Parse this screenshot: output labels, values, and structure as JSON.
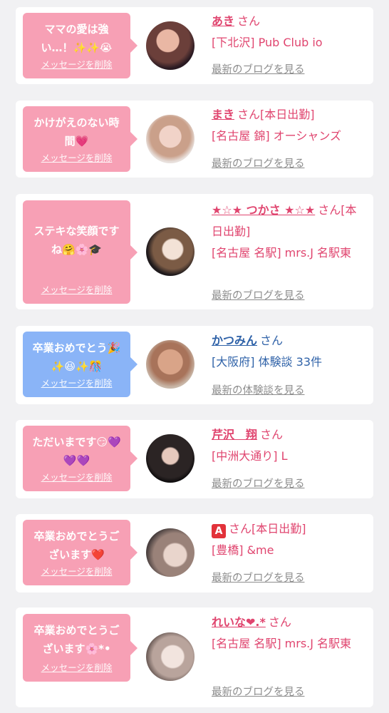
{
  "delete_label": "メッセージを削除",
  "suffix": "さん",
  "cards": [
    {
      "message": "ママの愛は強い…！✨✨😭",
      "name": "あき",
      "status": "",
      "shop": "[下北沢] Pub Club io",
      "link": "最新のブログを見る"
    },
    {
      "message": "かけがえのない時間💗",
      "name": "まき",
      "status": "[本日出勤]",
      "shop": "[名古屋 錦] オーシャンズ",
      "link": "最新のブログを見る"
    },
    {
      "message": "ステキな笑顔ですね🤗🌸🎓",
      "name": "★☆★ つかさ ★☆★",
      "status": "[本日出勤]",
      "shop": "[名古屋 名駅] mrs.J 名駅東",
      "link": "最新のブログを見る"
    },
    {
      "message": "卒業おめでとう🎉✨😆✨🎊",
      "name": "かつみん",
      "status": "",
      "shop": "[大阪府] 体験談 33件",
      "link": "最新の体験談を見る"
    },
    {
      "message": "ただいまです😏💜💜💜",
      "name": "芹沢　翔",
      "status": "",
      "shop": "[中洲大通り] L",
      "link": "最新のブログを見る"
    },
    {
      "message": "卒業おめでとうございます❤️",
      "name": "A",
      "status": "[本日出勤]",
      "shop": "[豊橋] &me",
      "link": "最新のブログを見る"
    },
    {
      "message": "卒業おめでとうございます🌸*•",
      "name": "れいな❤︎.*",
      "status": "",
      "shop": "[名古屋 名駅] mrs.J 名駅東",
      "link": "最新のブログを見る"
    }
  ],
  "colors": {
    "pink_bubble": "#f7a0b5",
    "blue_bubble": "#8ab4f7",
    "name_pink": "#e0456f",
    "name_blue": "#2f62a8",
    "link_gray": "#8d8d8d",
    "page_bg": "#f1f1f3"
  }
}
